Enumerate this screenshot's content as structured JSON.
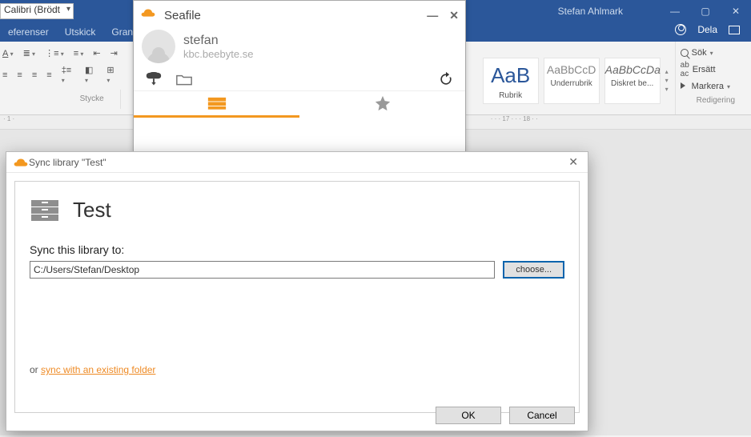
{
  "word": {
    "font_picker": "Calibri (Brödt",
    "user_name": "Stefan Ahlmark",
    "tabs": [
      "eferenser",
      "Utskick",
      "Granska"
    ],
    "share_label": "Dela",
    "stycke_label": "Stycke",
    "styles": {
      "rubrik": {
        "sample": "AaB",
        "label": "Rubrik"
      },
      "underrubrik": {
        "sample": "AaBbCcD",
        "label": "Underrubrik"
      },
      "diskret": {
        "sample": "AaBbCcDa",
        "label": "Diskret be..."
      }
    },
    "right": {
      "sok": "Sök",
      "ersatt": "Ersätt",
      "markera": "Markera",
      "group": "Redigering"
    },
    "ruler_left": "· 1 ·",
    "ruler_right": "· · · 17 · · · 18 · ·"
  },
  "seafile": {
    "title": "Seafile",
    "user": "stefan",
    "host": "kbc.beebyte.se"
  },
  "dialog": {
    "title": "Sync library \"Test\"",
    "lib_name": "Test",
    "sync_label": "Sync this library to:",
    "path_value": "C:/Users/Stefan/Desktop",
    "choose": "choose...",
    "or": "or ",
    "link": "sync with an existing folder",
    "ok": "OK",
    "cancel": "Cancel"
  }
}
